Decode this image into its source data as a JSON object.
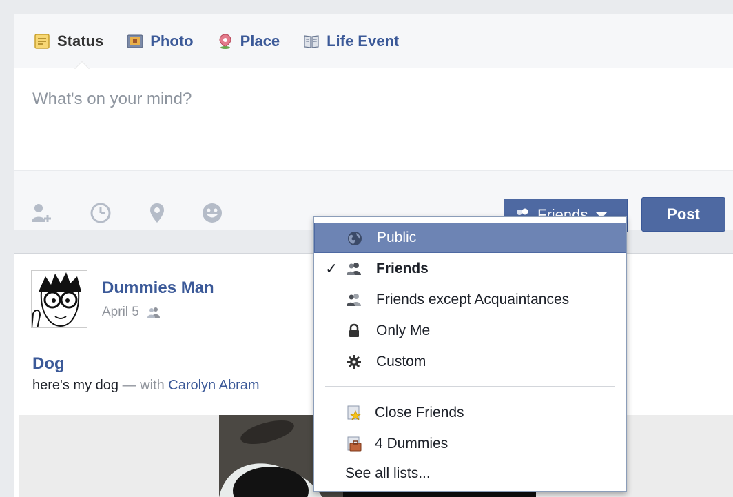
{
  "composer": {
    "tabs": [
      {
        "label": "Status",
        "icon": "status-note-icon",
        "active": true
      },
      {
        "label": "Photo",
        "icon": "photo-icon"
      },
      {
        "label": "Place",
        "icon": "place-pin-icon"
      },
      {
        "label": "Life Event",
        "icon": "life-event-book-icon"
      }
    ],
    "placeholder": "What's on your mind?",
    "tools": [
      "tag-people-icon",
      "clock-icon",
      "location-icon",
      "smiley-icon"
    ],
    "audience_label": "Friends",
    "post_label": "Post"
  },
  "post": {
    "author": "Dummies Man",
    "date": "April 5",
    "privacy_icon": "friends-icon",
    "title": "Dog",
    "text_prefix": "here's my dog",
    "text_with": "— with",
    "tagged": "Carolyn Abram"
  },
  "audience_menu": {
    "items": [
      {
        "label": "Public",
        "icon": "globe-icon",
        "highlighted": true
      },
      {
        "label": "Friends",
        "icon": "friends-icon",
        "checked": true
      },
      {
        "label": "Friends except Acquaintances",
        "icon": "friends-except-icon"
      },
      {
        "label": "Only Me",
        "icon": "lock-icon"
      },
      {
        "label": "Custom",
        "icon": "gear-icon"
      }
    ],
    "lists": [
      {
        "label": "Close Friends",
        "icon": "close-friends-star-icon"
      },
      {
        "label": "4 Dummies",
        "icon": "briefcase-list-icon"
      }
    ],
    "see_all": "See all lists...",
    "check_glyph": "✓"
  },
  "colors": {
    "brand_blue": "#3b5998",
    "button_blue": "#4e69a2",
    "highlight": "#6d84b4",
    "muted": "#90949c"
  }
}
